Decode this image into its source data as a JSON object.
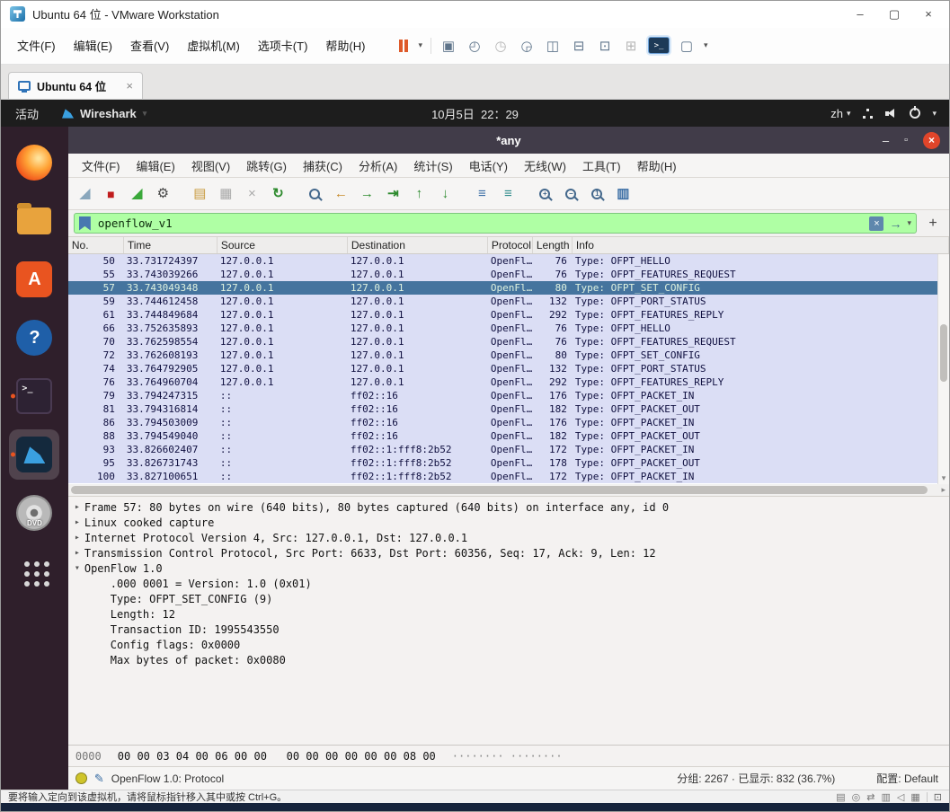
{
  "glyphs": {
    "caret_down": "▾",
    "close": "×",
    "apply_arrow": "→",
    "plus": "+",
    "pencil": "✎",
    "prompt": ">_",
    "scroll_down": "▾",
    "scroll_right": "▸"
  },
  "vmware": {
    "title": "Ubuntu 64 位 - VMware Workstation",
    "menu": [
      "文件(F)",
      "编辑(E)",
      "查看(V)",
      "虚拟机(M)",
      "选项卡(T)",
      "帮助(H)"
    ],
    "toolbar_icons": [
      {
        "name": "send-ctrl-alt-del-icon",
        "glyph": "▣"
      },
      {
        "name": "take-snapshot-icon",
        "glyph": "◴"
      },
      {
        "name": "revert-snapshot-icon",
        "glyph": "◷",
        "cls": "dim"
      },
      {
        "name": "manage-snapshots-icon",
        "glyph": "◶"
      },
      {
        "name": "show-library-icon",
        "glyph": "◫"
      },
      {
        "name": "show-thumbnail-bar-icon",
        "glyph": "⊟"
      },
      {
        "name": "fullscreen-icon",
        "glyph": "⊡"
      },
      {
        "name": "unity-mode-icon",
        "glyph": "⊞",
        "cls": "dim"
      }
    ],
    "stretch_glyph": "▢",
    "window_controls": [
      {
        "name": "minimize-button",
        "glyph": "–"
      },
      {
        "name": "maximize-button",
        "glyph": "▢"
      },
      {
        "name": "close-button",
        "glyph": "×"
      }
    ],
    "tab_label": "Ubuntu 64 位",
    "status_text": "要将输入定向到该虚拟机，请将鼠标指针移入其中或按 Ctrl+G。",
    "status_icons": [
      {
        "name": "message-log-icon",
        "glyph": "▤"
      },
      {
        "name": "cd-rom-icon",
        "glyph": "◎"
      },
      {
        "name": "network-adapter-icon",
        "glyph": "⇄"
      },
      {
        "name": "usb-device-icon",
        "glyph": "▥"
      },
      {
        "name": "sound-icon",
        "glyph": "◁"
      },
      {
        "name": "printer-icon",
        "glyph": "▦"
      }
    ],
    "restore_glyph": "⊡"
  },
  "ubuntu": {
    "activities": "活动",
    "app_menu": "Wireshark",
    "clock": "10月5日  22：29",
    "keyboard": "zh",
    "dock": [
      {
        "name": "firefox-icon",
        "cls": "firefox"
      },
      {
        "name": "files-icon",
        "cls": "files"
      },
      {
        "name": "ubuntu-software-icon",
        "cls": "software",
        "label": "A"
      },
      {
        "name": "help-icon",
        "cls": "help",
        "label": "?"
      },
      {
        "name": "terminal-icon",
        "cls": "terminal running",
        "label": ">_"
      },
      {
        "name": "wireshark-icon",
        "cls": "wireshark running active"
      },
      {
        "name": "dvd-icon",
        "cls": "dvd",
        "label": "DVD"
      },
      {
        "name": "show-applications-icon",
        "cls": "appgrid"
      }
    ]
  },
  "wireshark": {
    "title": "*any",
    "window_controls": [
      {
        "name": "minimize-button",
        "glyph": "–"
      },
      {
        "name": "maximize-button",
        "glyph": "▫",
        "cls": "max"
      },
      {
        "name": "close-button",
        "glyph": "×",
        "cls": "close-circle"
      }
    ],
    "menu": [
      "文件(F)",
      "编辑(E)",
      "视图(V)",
      "跳转(G)",
      "捕获(C)",
      "分析(A)",
      "统计(S)",
      "电话(Y)",
      "无线(W)",
      "工具(T)",
      "帮助(H)"
    ],
    "toolbar": [
      {
        "name": "start-capture-icon",
        "glyph": "◢",
        "cls": "fin"
      },
      {
        "name": "stop-capture-icon",
        "glyph": "■",
        "cls": "stop"
      },
      {
        "name": "restart-capture-icon",
        "glyph": "◢",
        "cls": "fin-g"
      },
      {
        "name": "capture-options-icon",
        "glyph": "⚙",
        "cls": "dark"
      },
      {
        "name": "open-file-icon",
        "glyph": "▤",
        "cls": "gold gap"
      },
      {
        "name": "save-file-icon",
        "glyph": "▦",
        "cls": "dim"
      },
      {
        "name": "close-file-icon",
        "glyph": "×",
        "cls": "dim"
      },
      {
        "name": "reload-file-icon",
        "glyph": "↻",
        "cls": "green"
      },
      {
        "name": "find-packet-icon",
        "glyph": "",
        "cls": "mag gap"
      },
      {
        "name": "go-back-icon",
        "glyph": "←",
        "cls": "amber"
      },
      {
        "name": "go-forward-icon",
        "glyph": "→",
        "cls": "green"
      },
      {
        "name": "go-to-packet-icon",
        "glyph": "⇥",
        "cls": "green"
      },
      {
        "name": "go-first-packet-icon",
        "glyph": "↑",
        "cls": "green"
      },
      {
        "name": "go-last-packet-icon",
        "glyph": "↓",
        "cls": "green"
      },
      {
        "name": "colorize-packets-icon",
        "glyph": "≡",
        "cls": "blue gap"
      },
      {
        "name": "auto-scroll-icon",
        "glyph": "≡",
        "cls": "teal"
      },
      {
        "name": "zoom-in-icon",
        "glyph": "+",
        "cls": "mag gap"
      },
      {
        "name": "zoom-out-icon",
        "glyph": "−",
        "cls": "mag"
      },
      {
        "name": "zoom-reset-icon",
        "glyph": "1",
        "cls": "mag"
      },
      {
        "name": "resize-columns-icon",
        "glyph": "▥",
        "cls": "blue"
      }
    ],
    "filter": {
      "value": "openflow_v1"
    },
    "columns": [
      "No.",
      "Time",
      "Source",
      "Destination",
      "Protocol",
      "Length",
      "Info"
    ],
    "rows": [
      {
        "no": "50",
        "time": "33.731724397",
        "src": "127.0.0.1",
        "dst": "127.0.0.1",
        "proto": "OpenFl…",
        "len": "76",
        "info": "Type: OFPT_HELLO"
      },
      {
        "no": "55",
        "time": "33.743039266",
        "src": "127.0.0.1",
        "dst": "127.0.0.1",
        "proto": "OpenFl…",
        "len": "76",
        "info": "Type: OFPT_FEATURES_REQUEST"
      },
      {
        "no": "57",
        "time": "33.743049348",
        "src": "127.0.0.1",
        "dst": "127.0.0.1",
        "proto": "OpenFl…",
        "len": "80",
        "info": "Type: OFPT_SET_CONFIG",
        "cls": "selected"
      },
      {
        "no": "59",
        "time": "33.744612458",
        "src": "127.0.0.1",
        "dst": "127.0.0.1",
        "proto": "OpenFl…",
        "len": "132",
        "info": "Type: OFPT_PORT_STATUS"
      },
      {
        "no": "61",
        "time": "33.744849684",
        "src": "127.0.0.1",
        "dst": "127.0.0.1",
        "proto": "OpenFl…",
        "len": "292",
        "info": "Type: OFPT_FEATURES_REPLY"
      },
      {
        "no": "66",
        "time": "33.752635893",
        "src": "127.0.0.1",
        "dst": "127.0.0.1",
        "proto": "OpenFl…",
        "len": "76",
        "info": "Type: OFPT_HELLO"
      },
      {
        "no": "70",
        "time": "33.762598554",
        "src": "127.0.0.1",
        "dst": "127.0.0.1",
        "proto": "OpenFl…",
        "len": "76",
        "info": "Type: OFPT_FEATURES_REQUEST"
      },
      {
        "no": "72",
        "time": "33.762608193",
        "src": "127.0.0.1",
        "dst": "127.0.0.1",
        "proto": "OpenFl…",
        "len": "80",
        "info": "Type: OFPT_SET_CONFIG"
      },
      {
        "no": "74",
        "time": "33.764792905",
        "src": "127.0.0.1",
        "dst": "127.0.0.1",
        "proto": "OpenFl…",
        "len": "132",
        "info": "Type: OFPT_PORT_STATUS"
      },
      {
        "no": "76",
        "time": "33.764960704",
        "src": "127.0.0.1",
        "dst": "127.0.0.1",
        "proto": "OpenFl…",
        "len": "292",
        "info": "Type: OFPT_FEATURES_REPLY"
      },
      {
        "no": "79",
        "time": "33.794247315",
        "src": "::",
        "dst": "ff02::16",
        "proto": "OpenFl…",
        "len": "176",
        "info": "Type: OFPT_PACKET_IN"
      },
      {
        "no": "81",
        "time": "33.794316814",
        "src": "::",
        "dst": "ff02::16",
        "proto": "OpenFl…",
        "len": "182",
        "info": "Type: OFPT_PACKET_OUT"
      },
      {
        "no": "86",
        "time": "33.794503009",
        "src": "::",
        "dst": "ff02::16",
        "proto": "OpenFl…",
        "len": "176",
        "info": "Type: OFPT_PACKET_IN"
      },
      {
        "no": "88",
        "time": "33.794549040",
        "src": "::",
        "dst": "ff02::16",
        "proto": "OpenFl…",
        "len": "182",
        "info": "Type: OFPT_PACKET_OUT"
      },
      {
        "no": "93",
        "time": "33.826602407",
        "src": "::",
        "dst": "ff02::1:fff8:2b52",
        "proto": "OpenFl…",
        "len": "172",
        "info": "Type: OFPT_PACKET_IN"
      },
      {
        "no": "95",
        "time": "33.826731743",
        "src": "::",
        "dst": "ff02::1:fff8:2b52",
        "proto": "OpenFl…",
        "len": "178",
        "info": "Type: OFPT_PACKET_OUT"
      },
      {
        "no": "100",
        "time": "33.827100651",
        "src": "::",
        "dst": "ff02::1:fff8:2b52",
        "proto": "OpenFl…",
        "len": "172",
        "info": "Type: OFPT_PACKET_IN"
      }
    ],
    "details": [
      {
        "arrow": "▸",
        "text": "Frame 57: 80 bytes on wire (640 bits), 80 bytes captured (640 bits) on interface any, id 0"
      },
      {
        "arrow": "▸",
        "text": "Linux cooked capture"
      },
      {
        "arrow": "▸",
        "text": "Internet Protocol Version 4, Src: 127.0.0.1, Dst: 127.0.0.1"
      },
      {
        "arrow": "▸",
        "text": "Transmission Control Protocol, Src Port: 6633, Dst Port: 60356, Seq: 17, Ack: 9, Len: 12"
      },
      {
        "arrow": "▾",
        "text": "OpenFlow 1.0"
      },
      {
        "arrow": "",
        "text": "    .000 0001 = Version: 1.0 (0x01)"
      },
      {
        "arrow": "",
        "text": "    Type: OFPT_SET_CONFIG (9)"
      },
      {
        "arrow": "",
        "text": "    Length: 12"
      },
      {
        "arrow": "",
        "text": "    Transaction ID: 1995543550"
      },
      {
        "arrow": "",
        "text": "    Config flags: 0x0000"
      },
      {
        "arrow": "",
        "text": "    Max bytes of packet: 0x0080"
      }
    ],
    "hex": {
      "offset": "0000",
      "bytes": "00 00 03 04 00 06 00 00   00 00 00 00 00 00 08 00",
      "ascii": "········ ········"
    },
    "status": {
      "left": "OpenFlow 1.0: Protocol",
      "packets": "分组: 2267 · 已显示: 832 (36.7%)",
      "profile": "配置: Default"
    }
  }
}
